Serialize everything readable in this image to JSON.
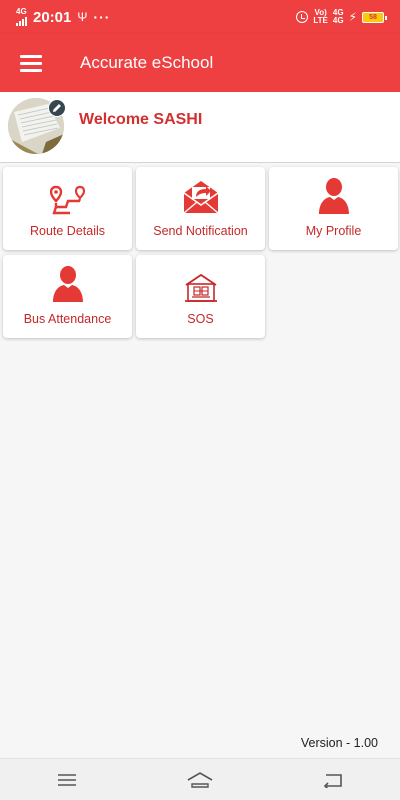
{
  "status_bar": {
    "network": "4G",
    "time": "20:01",
    "volte_top": "Vo)",
    "volte_bottom": "LTE",
    "net2_top": "4G",
    "net2_bottom": "4G",
    "battery": "58"
  },
  "app_bar": {
    "title": "Accurate eSchool",
    "menu_icon": "hamburger-menu-icon"
  },
  "profile": {
    "welcome": "Welcome SASHI"
  },
  "tiles": [
    {
      "label": "Route Details",
      "icon": "route-icon"
    },
    {
      "label": "Send Notification",
      "icon": "envelope-send-icon"
    },
    {
      "label": "My Profile",
      "icon": "person-icon"
    },
    {
      "label": "Bus Attendance",
      "icon": "person-icon"
    },
    {
      "label": "SOS",
      "icon": "school-building-icon"
    }
  ],
  "version": "Version - 1.00",
  "colors": {
    "primary": "#ee3f41",
    "tile_text": "#c62828",
    "icon": "#e53935"
  }
}
